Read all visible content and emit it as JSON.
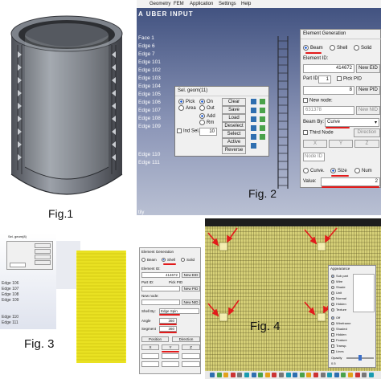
{
  "fig1": {
    "caption": "Fig.1"
  },
  "fig2": {
    "caption": "Fig. 2",
    "menu": [
      "Geometry",
      "FEM",
      "Application",
      "Settings",
      "Help"
    ],
    "header_text": "A UBER INPUT",
    "tree_items": [
      "Face 1",
      "Edge 6",
      "Edge 7",
      "Edge 101",
      "Edge 102",
      "Edge 103",
      "Edge 104",
      "Edge 105",
      "Edge 106",
      "Edge 107",
      "Edge 108",
      "Edge 109",
      "Edge 110",
      "Edge 111"
    ],
    "bottom_label": "tily",
    "sel_geom": {
      "title": "Sel. geom(11)",
      "pick": "Pick",
      "area": "Area",
      "on": "On",
      "out": "Out",
      "add": "Add",
      "rm": "Rm",
      "ind_sel": "Ind Sel.",
      "ind_value": "10",
      "buttons": [
        "Clear",
        "Save",
        "Load",
        "Deselect",
        "Select",
        "Active",
        "Reverse"
      ]
    },
    "element_gen": {
      "title": "Element Generation",
      "types": [
        "Beam",
        "Shell",
        "Solid"
      ],
      "element_id_label": "Element ID:",
      "element_id_value": "414672",
      "new_eid_button": "New EID",
      "part_id_label": "Part ID:",
      "part_id_value": "1",
      "pick_pid_label": "Pick PID",
      "pid_value": "8",
      "new_pid_button": "New PID",
      "new_node_label": "New node:",
      "new_node_value": "631378",
      "new_nid_button": "New NID",
      "beam_by_label": "Beam By:",
      "beam_by_value": "Curve",
      "third_node_label": "Third Node",
      "direction_button": "Direction",
      "xyz": [
        "X",
        "Y",
        "Z"
      ],
      "node_id_label": "Node ID",
      "size_options": [
        "Curve.",
        "Size",
        "Num"
      ],
      "value_label": "Value:",
      "value": "2"
    }
  },
  "fig3": {
    "caption": "Fig. 3",
    "tree_items": [
      "Edge 106",
      "Edge 107",
      "Edge 108",
      "Edge 109"
    ],
    "small_labels": [
      "Sel. geom(8)",
      "Edge 110",
      "Edge 111"
    ],
    "panel": {
      "title": "Element Generation",
      "types": [
        "Beam",
        "Shell",
        "Solid"
      ],
      "element_id_label": "Element ID:",
      "element_id_value": "414672",
      "new_eid_button": "New EID",
      "part_id_label": "Part ID:",
      "pick_pid_label": "Pick PID",
      "new_pid_button": "New PID",
      "new_node_label": "New node:",
      "new_nid_button": "New NID",
      "shell_by_label": "Shell By:",
      "shell_by_value": "Edge Spin",
      "angle_label": "Angle",
      "angle_value": "360",
      "segment_label": "Segment",
      "segment_value": "360",
      "position_button": "Position",
      "direction_button": "Direction",
      "xyz": [
        "X",
        "Y",
        "Z"
      ]
    }
  },
  "fig4": {
    "caption": "Fig. 4",
    "appearance": {
      "title": "Appearance",
      "sections": [
        "Sub part",
        "Wire",
        "Shade",
        "Unit",
        "Normal",
        "Hidden",
        "Texture"
      ],
      "options": [
        "Off",
        "Wireframe",
        "Shaded",
        "Hidden",
        "Feature",
        "Transp.",
        "Lines"
      ],
      "slider_label": "Opacity",
      "slider_value": "0.5"
    },
    "taskbar_icons": 24
  }
}
